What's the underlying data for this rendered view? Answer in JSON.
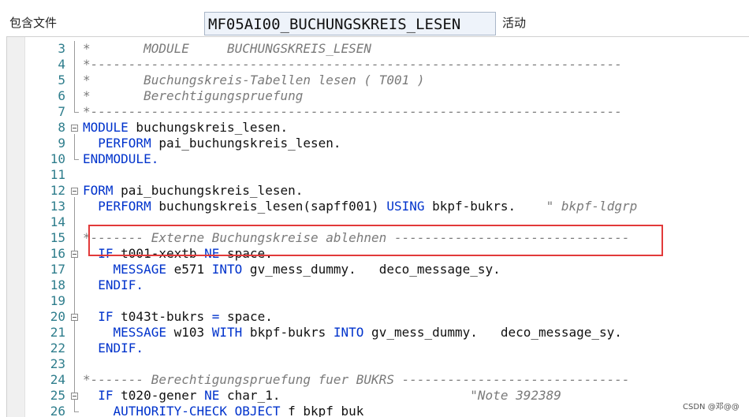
{
  "header": {
    "include_label": "包含文件",
    "program_name": "MF05AI00_BUCHUNGSKREIS_LESEN",
    "status_label": "活动"
  },
  "lines": [
    {
      "num": "3",
      "segments": [
        [
          "cm",
          "*       MODULE     BUCHUNGSKREIS_LESEN"
        ]
      ]
    },
    {
      "num": "4",
      "segments": [
        [
          "cm",
          "*----------------------------------------------------------------------"
        ]
      ]
    },
    {
      "num": "5",
      "segments": [
        [
          "cm",
          "*       Buchungskreis-Tabellen lesen ( T001 )"
        ]
      ]
    },
    {
      "num": "6",
      "segments": [
        [
          "cm",
          "*       Berechtigungspruefung"
        ]
      ]
    },
    {
      "num": "7",
      "segments": [
        [
          "cm",
          "*----------------------------------------------------------------------"
        ]
      ]
    },
    {
      "num": "8",
      "segments": [
        [
          "kw",
          "MODULE"
        ],
        [
          "tx",
          " buchungskreis_lesen."
        ]
      ]
    },
    {
      "num": "9",
      "segments": [
        [
          "tx",
          "  "
        ],
        [
          "kw",
          "PERFORM"
        ],
        [
          "tx",
          " pai_buchungskreis_lesen."
        ]
      ]
    },
    {
      "num": "10",
      "segments": [
        [
          "kw",
          "ENDMODULE."
        ]
      ]
    },
    {
      "num": "11",
      "segments": [
        [
          "tx",
          ""
        ]
      ]
    },
    {
      "num": "12",
      "segments": [
        [
          "kw",
          "FORM"
        ],
        [
          "tx",
          " pai_buchungskreis_lesen."
        ]
      ]
    },
    {
      "num": "13",
      "segments": [
        [
          "tx",
          "  "
        ],
        [
          "kw",
          "PERFORM"
        ],
        [
          "tx",
          " buchungskreis_lesen(sapff001) "
        ],
        [
          "kw",
          "USING"
        ],
        [
          "tx",
          " bkpf-bukrs.  "
        ],
        [
          "cm",
          "  \" bkpf-ldgrp"
        ]
      ]
    },
    {
      "num": "14",
      "segments": [
        [
          "tx",
          ""
        ]
      ]
    },
    {
      "num": "15",
      "segments": [
        [
          "cm",
          "*------- Externe Buchungskreise ablehnen -------------------------------"
        ]
      ]
    },
    {
      "num": "16",
      "segments": [
        [
          "tx",
          "  "
        ],
        [
          "kw",
          "IF"
        ],
        [
          "tx",
          " t001-xextb "
        ],
        [
          "kw",
          "NE"
        ],
        [
          "tx",
          " space."
        ]
      ]
    },
    {
      "num": "17",
      "segments": [
        [
          "tx",
          "    "
        ],
        [
          "kw",
          "MESSAGE"
        ],
        [
          "tx",
          " e571 "
        ],
        [
          "kw",
          "INTO"
        ],
        [
          "tx",
          " gv_mess_dummy.   deco_message_sy."
        ]
      ]
    },
    {
      "num": "18",
      "segments": [
        [
          "tx",
          "  "
        ],
        [
          "kw",
          "ENDIF."
        ]
      ]
    },
    {
      "num": "19",
      "segments": [
        [
          "tx",
          ""
        ]
      ]
    },
    {
      "num": "20",
      "segments": [
        [
          "tx",
          "  "
        ],
        [
          "kw",
          "IF"
        ],
        [
          "tx",
          " t043t-bukrs "
        ],
        [
          "kw",
          "="
        ],
        [
          "tx",
          " space."
        ]
      ]
    },
    {
      "num": "21",
      "segments": [
        [
          "tx",
          "    "
        ],
        [
          "kw",
          "MESSAGE"
        ],
        [
          "tx",
          " w103 "
        ],
        [
          "kw",
          "WITH"
        ],
        [
          "tx",
          " bkpf-bukrs "
        ],
        [
          "kw",
          "INTO"
        ],
        [
          "tx",
          " gv_mess_dummy.   deco_message_sy."
        ]
      ]
    },
    {
      "num": "22",
      "segments": [
        [
          "tx",
          "  "
        ],
        [
          "kw",
          "ENDIF."
        ]
      ]
    },
    {
      "num": "23",
      "segments": [
        [
          "tx",
          ""
        ]
      ]
    },
    {
      "num": "24",
      "segments": [
        [
          "cm",
          "*------- Berechtigungspruefung fuer BUKRS ------------------------------"
        ]
      ]
    },
    {
      "num": "25",
      "segments": [
        [
          "tx",
          "  "
        ],
        [
          "kw",
          "IF"
        ],
        [
          "tx",
          " t020-gener "
        ],
        [
          "kw",
          "NE"
        ],
        [
          "tx",
          " char_1.                         "
        ],
        [
          "cm",
          "\"Note 392389"
        ]
      ]
    },
    {
      "num": "26",
      "segments": [
        [
          "tx",
          "    "
        ],
        [
          "kw",
          "AUTHORITY-CHECK OBJECT"
        ],
        [
          "tx",
          " f_bkpf_buk"
        ]
      ]
    }
  ],
  "watermark": "CSDN @邓@@",
  "colors": {
    "keyword": "#0033cc",
    "comment": "#7a7a7a",
    "line_number": "#2e7d8c",
    "highlight_box": "#e23a3a"
  }
}
